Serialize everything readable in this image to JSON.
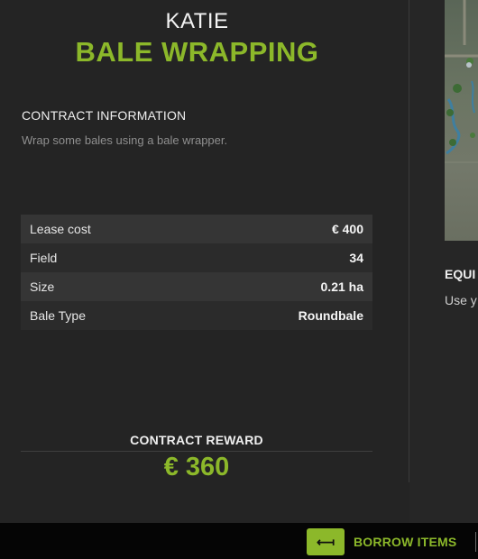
{
  "contract": {
    "contractor": "KATIE",
    "title": "BALE WRAPPING",
    "section_header": "CONTRACT INFORMATION",
    "description": "Wrap some bales using a bale wrapper."
  },
  "details": [
    {
      "label": "Lease cost",
      "value": "€ 400"
    },
    {
      "label": "Field",
      "value": "34"
    },
    {
      "label": "Size",
      "value": "0.21 ha"
    },
    {
      "label": "Bale Type",
      "value": "Roundbale"
    }
  ],
  "reward": {
    "label": "CONTRACT REWARD",
    "value": "€ 360"
  },
  "right_panel": {
    "heading": "EQUI",
    "text": "Use y"
  },
  "bottom_bar": {
    "key_symbol": "⟻",
    "borrow_label": "BORROW ITEMS"
  },
  "colors": {
    "accent": "#8cb82a",
    "background": "#242424",
    "row_light": "#353535",
    "row_dark": "#2b2b2b",
    "bottom_bar": "#050505"
  },
  "icons": {
    "borrow_key": "back-arrow-icon",
    "map": "field-map-thumbnail"
  }
}
